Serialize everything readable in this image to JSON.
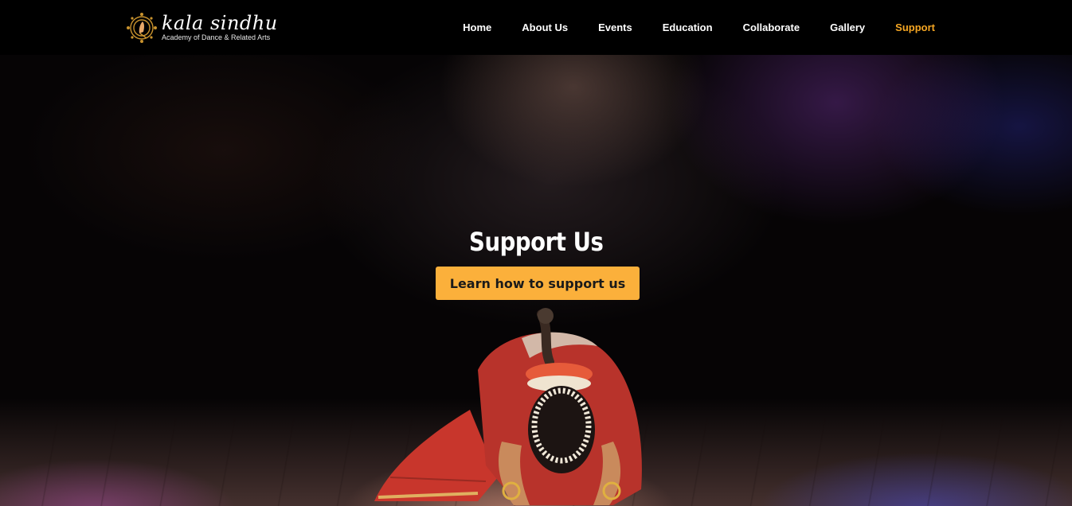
{
  "brand": {
    "logo_title": "kala sindhu",
    "logo_subtitle": "Academy of Dance & Related Arts",
    "emblem_icon": "dancer-emblem-icon",
    "gold_color": "#c9932e"
  },
  "nav": {
    "items": [
      {
        "label": "Home",
        "active": false
      },
      {
        "label": "About Us",
        "active": false
      },
      {
        "label": "Events",
        "active": false
      },
      {
        "label": "Education",
        "active": false
      },
      {
        "label": "Collaborate",
        "active": false
      },
      {
        "label": "Gallery",
        "active": false
      },
      {
        "label": "Support",
        "active": true
      }
    ],
    "active_color": "#f5a623"
  },
  "hero": {
    "title": "Support Us",
    "cta_label": "Learn how to support us",
    "cta_color": "#fbb03b",
    "image": "dancer-bowing-on-stage"
  }
}
